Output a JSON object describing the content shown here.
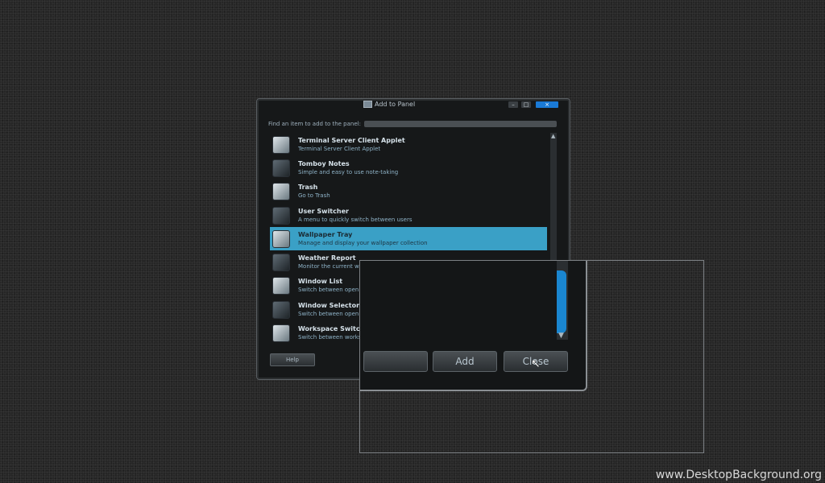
{
  "window": {
    "title": "Add to Panel",
    "find_label": "Find an item to add to the panel:",
    "search_value": "",
    "items": [
      {
        "name": "Terminal Server Client Applet",
        "desc": "Terminal Server Client Applet",
        "icon": "terminal-server-icon"
      },
      {
        "name": "Tomboy Notes",
        "desc": "Simple and easy to use note-taking",
        "icon": "notes-icon"
      },
      {
        "name": "Trash",
        "desc": "Go to Trash",
        "icon": "trash-icon"
      },
      {
        "name": "User Switcher",
        "desc": "A menu to quickly switch between users",
        "icon": "user-switcher-icon"
      },
      {
        "name": "Wallpaper Tray",
        "desc": "Manage and display your wallpaper collection",
        "icon": "wallpaper-tray-icon"
      },
      {
        "name": "Weather Report",
        "desc": "Monitor the current wea",
        "icon": "weather-icon"
      },
      {
        "name": "Window List",
        "desc": "Switch between open wi",
        "icon": "window-list-icon"
      },
      {
        "name": "Window Selector",
        "desc": "Switch between open wi",
        "icon": "window-selector-icon"
      },
      {
        "name": "Workspace Switcher",
        "desc": "Switch between worksp",
        "icon": "workspace-switcher-icon"
      }
    ],
    "selected_index": 4,
    "help_label": "Help",
    "controls": {
      "minimize": "–",
      "maximize": "□",
      "close": "×"
    }
  },
  "zoom": {
    "button_1": "",
    "add_label": "Add",
    "close_label": "Close"
  },
  "watermark": "www.DesktopBackground.org"
}
